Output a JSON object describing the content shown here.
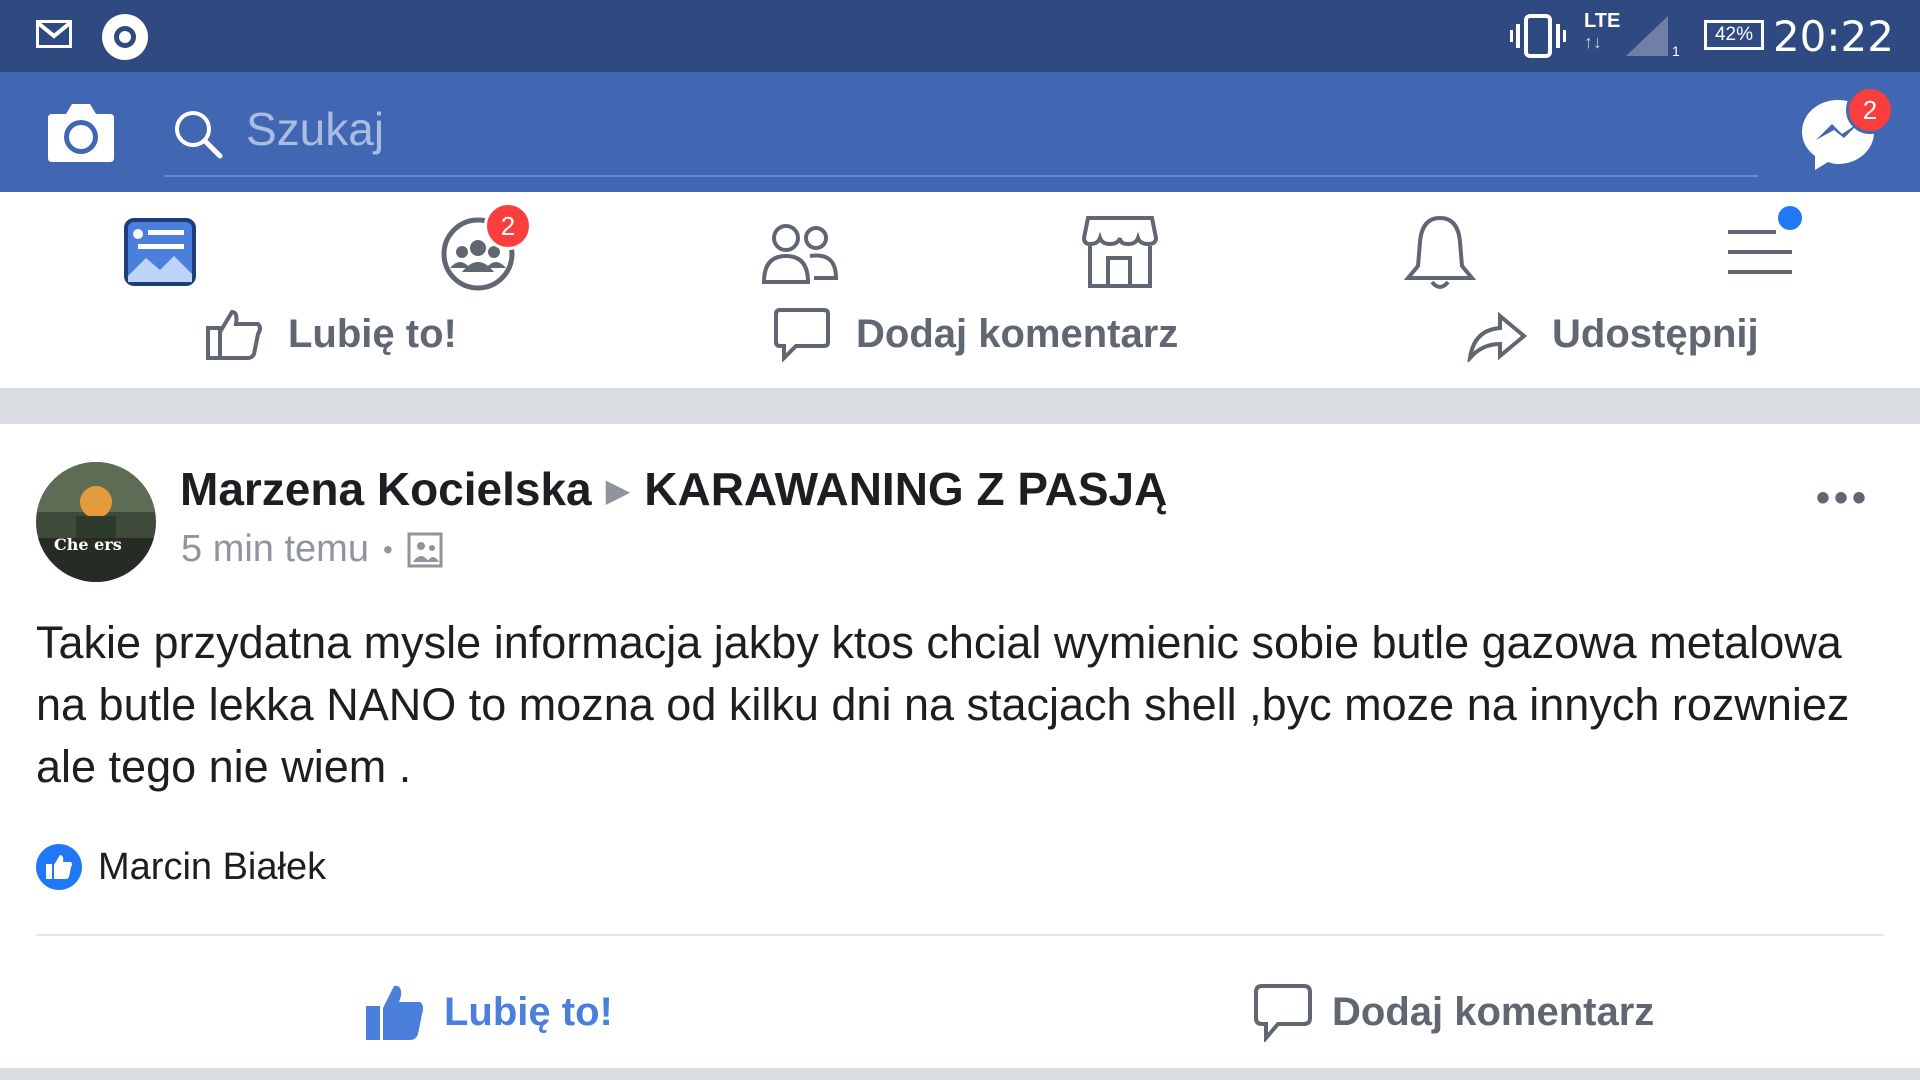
{
  "status_bar": {
    "time": "20:22",
    "battery": "42%",
    "network": "LTE",
    "icons": [
      "mail-icon",
      "media-icon",
      "vibrate-icon",
      "lte-icon",
      "signal-icon",
      "battery-icon"
    ]
  },
  "top_bar": {
    "search_placeholder": "Szukaj",
    "messenger_badge": "2",
    "icons": [
      "camera-icon",
      "search-icon",
      "messenger-icon"
    ]
  },
  "nav": {
    "groups_badge": "2",
    "tabs": [
      "news-feed-icon",
      "groups-icon",
      "friends-icon",
      "marketplace-icon",
      "notifications-icon",
      "menu-icon"
    ]
  },
  "previous_post_actions": {
    "like": "Lubię to!",
    "comment": "Dodaj komentarz",
    "share": "Udostępnij"
  },
  "post": {
    "author": "Marzena Kocielska",
    "group": "KARAWANING Z PASJĄ",
    "time": "5 min temu",
    "avatar_text": "Che  ers",
    "text": "Takie przydatna mysle informacja jakby ktos chcial wymienic sobie butle gazowa metalowa na butle lekka NANO to mozna od kilku dni na stacjach shell ,byc moze na innych rozwniez ale tego nie wiem .",
    "reaction_by": "Marcin Białek",
    "like_label": "Lubię to!",
    "comment_label": "Dodaj komentarz"
  },
  "colors": {
    "status_bar": "#2f4a80",
    "header": "#4267b2",
    "accent_blue": "#4a7fdb",
    "badge_red": "#fa3e3e"
  }
}
